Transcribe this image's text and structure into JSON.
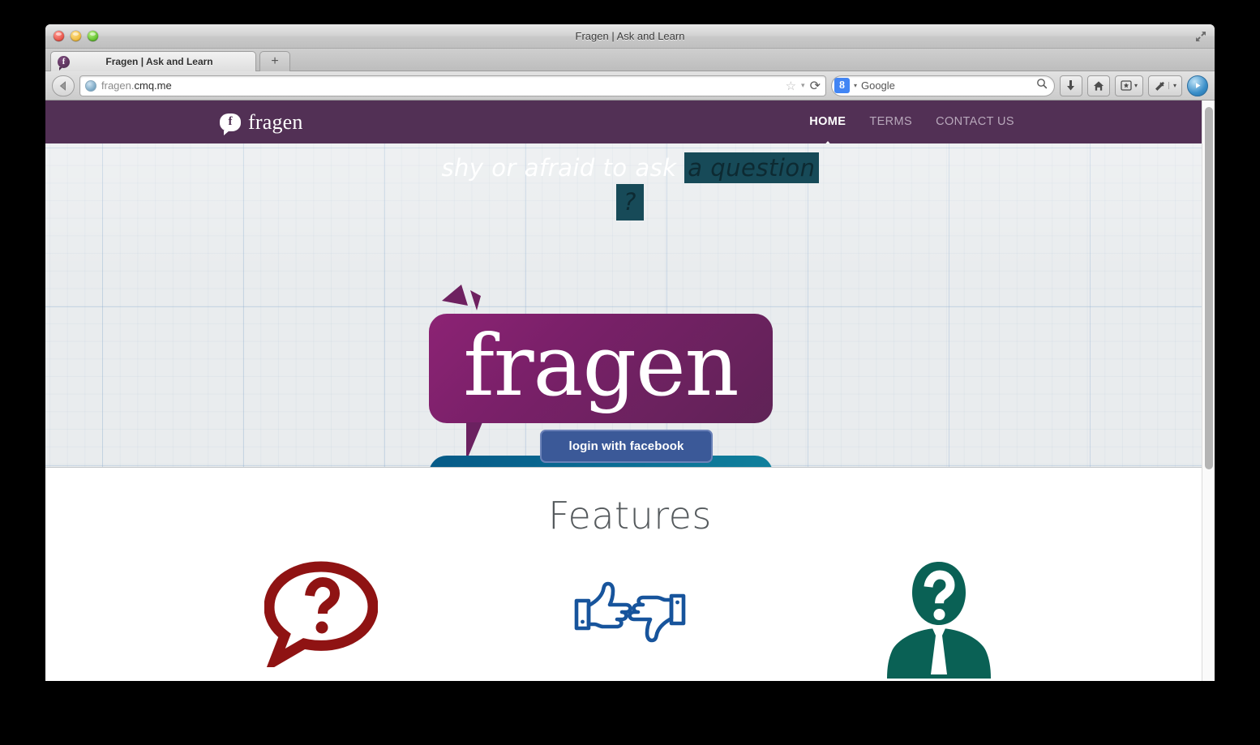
{
  "window": {
    "title": "Fragen | Ask and Learn",
    "traffic_lights": [
      "close",
      "minimize",
      "zoom"
    ],
    "fullscreen_icon": "fullscreen-arrows-icon"
  },
  "tabs": {
    "active": {
      "label": "Fragen | Ask and Learn",
      "favicon": "f"
    },
    "new_tab_label": "+"
  },
  "toolbar": {
    "back_icon": "back-arrow-icon",
    "url": {
      "host": "fragen.",
      "domain": "cmq.me",
      "full": "fragen.cmq.me"
    },
    "star_icon": "☆",
    "star_caret": "▾",
    "reload_icon": "⟳",
    "search": {
      "engine_badge": "8",
      "engine_caret": "▾",
      "placeholder": "Google",
      "search_icon": "search-magnifier-icon"
    },
    "buttons": [
      {
        "name": "downloads",
        "icon": "⬇"
      },
      {
        "name": "home",
        "icon": "⌂"
      },
      {
        "name": "bookmarks",
        "icon": "bookmark-star-icon",
        "caret": "▾"
      },
      {
        "name": "customize",
        "icon": "tools-icon",
        "caret": "▾"
      },
      {
        "name": "sync",
        "icon": "sync-icon"
      }
    ]
  },
  "site": {
    "brand": {
      "mark": "f",
      "name": "fragen"
    },
    "nav": [
      {
        "label": "HOME",
        "active": true
      },
      {
        "label": "TERMS",
        "active": false
      },
      {
        "label": "CONTACT US",
        "active": false
      }
    ],
    "hero": {
      "wordmark": "fragen",
      "login_button": "login with facebook",
      "tagline_part1": "shy or afraid to ask ",
      "tagline_highlight": "a question",
      "tagline_mark": "?"
    },
    "features": {
      "title": "Features",
      "items": [
        {
          "icon": "question-speech-bubble-icon",
          "color": "#8f1313"
        },
        {
          "icon": "thumbs-up-down-icon",
          "color": "#17549c"
        },
        {
          "icon": "anonymous-person-icon",
          "color": "#0a6155"
        }
      ]
    }
  },
  "scrollbar": {
    "orientation": "vertical"
  },
  "colors": {
    "header_purple": "#523055",
    "bubble_purple": "#8c2374",
    "bubble_blue": "#065a87",
    "facebook_blue": "#3b5998",
    "hero_paper": "#e9ecee"
  }
}
